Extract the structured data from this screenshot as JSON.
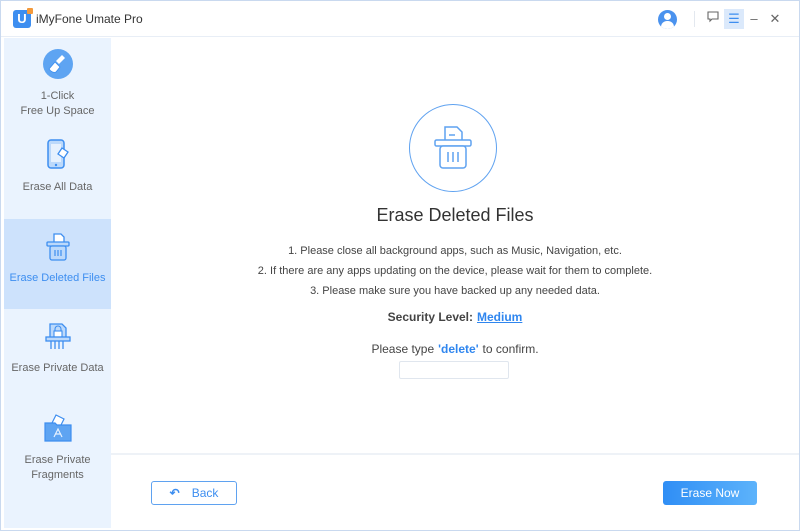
{
  "app": {
    "title": "iMyFone Umate Pro",
    "logo_letter": "U"
  },
  "titlebar": {
    "feedback_icon": "□",
    "menu_icon": "☰",
    "minimize_icon": "–",
    "close_icon": "✕"
  },
  "sidebar": {
    "items": [
      {
        "label_line1": "1-Click",
        "label_line2": "Free Up Space",
        "icon": "broom-icon",
        "active": false
      },
      {
        "label_line1": "Erase All Data",
        "icon": "phone-eraser-icon",
        "active": false
      },
      {
        "label_line1": "Erase Deleted Files",
        "icon": "trash-file-icon",
        "active": true
      },
      {
        "label_line1": "Erase Private Data",
        "icon": "lock-shredder-icon",
        "active": false
      },
      {
        "label_line1": "Erase Private",
        "label_line2": "Fragments",
        "icon": "folder-app-icon",
        "active": false
      }
    ]
  },
  "main": {
    "heading": "Erase Deleted Files",
    "steps": [
      "1. Please close all background apps, such as Music, Navigation, etc.",
      "2. If there are any apps updating on the device, please wait for them to complete.",
      "3. Please make sure you have backed up any needed data."
    ],
    "security_label": "Security Level:",
    "security_value": "Medium",
    "confirm_prefix": "Please type",
    "confirm_keyword": "'delete'",
    "confirm_suffix": "to confirm.",
    "confirm_input_value": ""
  },
  "footer": {
    "back_label": "Back",
    "back_icon": "↶",
    "erase_label": "Erase Now"
  },
  "colors": {
    "accent": "#3d8ef0",
    "sidebar_bg": "#eaf3fe",
    "sidebar_active": "#cde2fc"
  }
}
